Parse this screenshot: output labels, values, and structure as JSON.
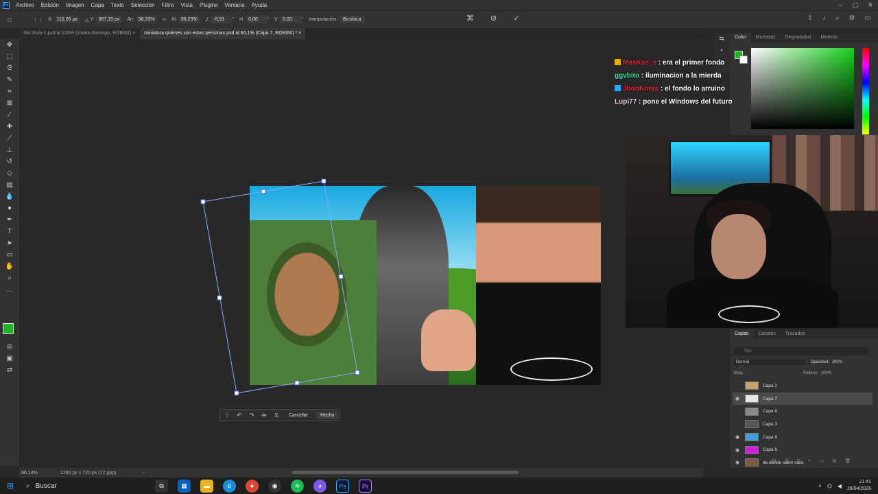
{
  "menu": {
    "app_logo": "Ps",
    "items": [
      "Archivo",
      "Edición",
      "Imagen",
      "Capa",
      "Texto",
      "Selección",
      "Filtro",
      "Vista",
      "Plugins",
      "Ventana",
      "Ayuda"
    ]
  },
  "options": {
    "x_label": "X:",
    "x_value": "112,05 px",
    "y_label": "Y:",
    "y_value": "367,19 px",
    "w_label": "An:",
    "w_value": "98,23%",
    "h_label": "Al:",
    "h_value": "98,23%",
    "angle_value": "-9,91",
    "hskew_label": "H:",
    "hskew_value": "0,00",
    "vskew_label": "V:",
    "vskew_value": "0,00",
    "interp_label": "Interpolación:",
    "interp_value": "Bicúbica"
  },
  "tabs": [
    {
      "label": "Sin título-1.psd al 100% (charla domingo, RGB/8#)"
    },
    {
      "label": "miniatura quienes son estas personas.psd al 60,1% (Capa 7, RGB/8#) *"
    }
  ],
  "context_bar": {
    "cancel_label": "Cancelar",
    "done_label": "Hecho"
  },
  "status": {
    "zoom": "60,14%",
    "doc_info": "1280 px x 720 px (72 ppp)"
  },
  "color_panel": {
    "tabs": [
      "Color",
      "Muestras",
      "Degradados",
      "Motivos"
    ],
    "foreground": "#1fb31f"
  },
  "chat": [
    {
      "user": "MasKas_s",
      "sep": " : ",
      "msg": "era el primer fondo",
      "color": "#e0243e",
      "badge": "#e3b014"
    },
    {
      "user": "ggvbito",
      "sep": " : ",
      "msg": "iluminacion a la mierda",
      "color": "#44e0a0",
      "badge": ""
    },
    {
      "user": "JhonKoras",
      "sep": " : ",
      "msg": "el fondo lo arruino",
      "color": "#e0243e",
      "badge": "#33a3ff"
    },
    {
      "user": "Lupi77",
      "sep": " : ",
      "msg": "pone el Windows del futuro",
      "color": "#f2c8e8",
      "badge": ""
    }
  ],
  "layers_panel": {
    "tabs": [
      "Capas",
      "Canales",
      "Trazados"
    ],
    "search_placeholder": "Tipo",
    "blend_mode": "Normal",
    "opacity_label": "Opacidad:",
    "opacity_value": "100%",
    "lock_label": "Bloq.:",
    "fill_label": "Relleno:",
    "fill_value": "100%",
    "layers": [
      {
        "name": "Capa 2",
        "visible": false,
        "selected": false,
        "thumb": "#c9a16a"
      },
      {
        "name": "Capa 7",
        "visible": true,
        "selected": true,
        "thumb": "#e6e6e6"
      },
      {
        "name": "Capa 6",
        "visible": false,
        "selected": false,
        "thumb": "#8a8a8a"
      },
      {
        "name": "Capa 3",
        "visible": false,
        "selected": false,
        "thumb": "#555555"
      },
      {
        "name": "Capa 9",
        "visible": true,
        "selected": false,
        "thumb": "#3fa0d8"
      },
      {
        "name": "Capa 8",
        "visible": true,
        "selected": false,
        "thumb": "#d020d8"
      },
      {
        "name": "de donde salen cara",
        "visible": true,
        "selected": false,
        "thumb": "#7a5a4a"
      }
    ]
  },
  "taskbar": {
    "search_label": "Buscar",
    "time": "21:41",
    "date": "26/04/2026"
  }
}
